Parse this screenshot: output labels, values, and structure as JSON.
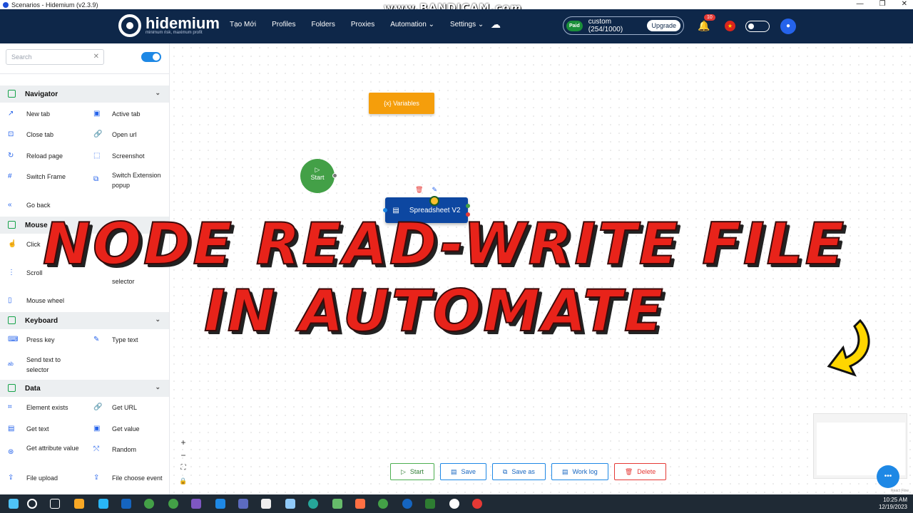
{
  "window": {
    "title": "Scenarios - Hidemium (v2.3.9)",
    "buttons": [
      "—",
      "❐",
      "✕"
    ]
  },
  "watermark": "www.BANDICAM.com",
  "header": {
    "logo_text": "hidemium",
    "logo_sub": "minimum risk, maximum profit",
    "nav": [
      "Tạo Mới",
      "Profiles",
      "Folders",
      "Proxies",
      "Automation ⌄",
      "Settings ⌄"
    ],
    "plan_badge": "Paid",
    "plan_text": "custom (254/1000)",
    "upgrade": "Upgrade",
    "notifications": "10"
  },
  "sidebar": {
    "search_placeholder": "Search",
    "sections": {
      "navigator": "Navigator",
      "mouse": "Mouse",
      "keyboard": "Keyboard",
      "data": "Data"
    },
    "items": {
      "new_tab": "New tab",
      "active_tab": "Active tab",
      "close_tab": "Close tab",
      "open_url": "Open url",
      "reload_page": "Reload page",
      "screenshot": "Screenshot",
      "switch_frame": "Switch Frame",
      "switch_extension": "Switch Extension popup",
      "go_back": "Go back",
      "click": "Click",
      "scroll": "Scroll",
      "scroll_selector": "selector",
      "mouse_wheel": "Mouse wheel",
      "press_key": "Press key",
      "type_text": "Type text",
      "send_text": "Send text to selector",
      "element_exists": "Element exists",
      "get_url": "Get URL",
      "get_text": "Get text",
      "get_value": "Get value",
      "get_attribute": "Get attribute value",
      "random": "Random",
      "file_upload": "File upload",
      "file_choose": "File choose event"
    }
  },
  "canvas": {
    "variables_node": "{x}  Variables",
    "start_node": "Start",
    "spreadsheet_node": "Spreadsheet V2"
  },
  "overlay": {
    "line1": "NODE READ-WRITE FILE",
    "line2": "IN AUTOMATE"
  },
  "bottom": {
    "start": "Start",
    "save": "Save",
    "save_as": "Save as",
    "work_log": "Work log",
    "delete": "Delete"
  },
  "reactflow": "React Flow",
  "tray": {
    "time": "10:25 AM",
    "date": "12/19/2023"
  }
}
